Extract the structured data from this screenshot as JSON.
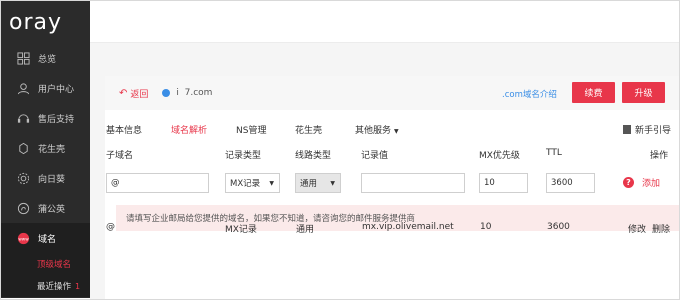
{
  "sidebar": {
    "logo": "oray",
    "items": [
      {
        "label": "总览",
        "icon": "grid-icon"
      },
      {
        "label": "用户中心",
        "icon": "user-icon"
      },
      {
        "label": "售后支持",
        "icon": "headset-icon"
      },
      {
        "label": "花生壳",
        "icon": "peanut-icon"
      },
      {
        "label": "向日葵",
        "icon": "sunflower-icon"
      },
      {
        "label": "蒲公英",
        "icon": "dandelion-icon"
      },
      {
        "label": "域名",
        "icon": "www-icon"
      }
    ],
    "sub_items": [
      {
        "label": "顶级域名"
      },
      {
        "label": "最近操作",
        "badge": "1"
      }
    ]
  },
  "domain_bar": {
    "back_label": "返回",
    "domain": "i  7.com",
    "intro_link": ".com域名介绍",
    "renew_label": "续费",
    "upgrade_label": "升级"
  },
  "tabs": [
    {
      "label": "基本信息"
    },
    {
      "label": "域名解析"
    },
    {
      "label": "NS管理"
    },
    {
      "label": "花生壳"
    },
    {
      "label": "其他服务"
    }
  ],
  "guide_label": "新手引导",
  "table": {
    "headers": [
      "子域名",
      "记录类型",
      "线路类型",
      "记录值",
      "MX优先级",
      "TTL",
      "操作"
    ],
    "input_row": {
      "subdomain": "@",
      "record_type": "MX记录",
      "line_type": "通用",
      "record_value": "",
      "mx_priority": "10",
      "ttl": "3600",
      "add_label": "添加"
    },
    "hint": "请填写企业邮局给您提供的域名，如果您不知道，请咨询您的邮件服务提供商",
    "rows": [
      {
        "subdomain": "@",
        "record_type": "MX记录",
        "line_type": "通用",
        "record_value": "mx.vip.olivemail.net",
        "mx_priority": "10",
        "ttl": "3600",
        "edit_label": "修改",
        "delete_label": "删除"
      }
    ]
  },
  "colors": {
    "accent": "#e8364a",
    "link": "#3a8ee6",
    "sidebar_bg": "#2b2b2b"
  }
}
